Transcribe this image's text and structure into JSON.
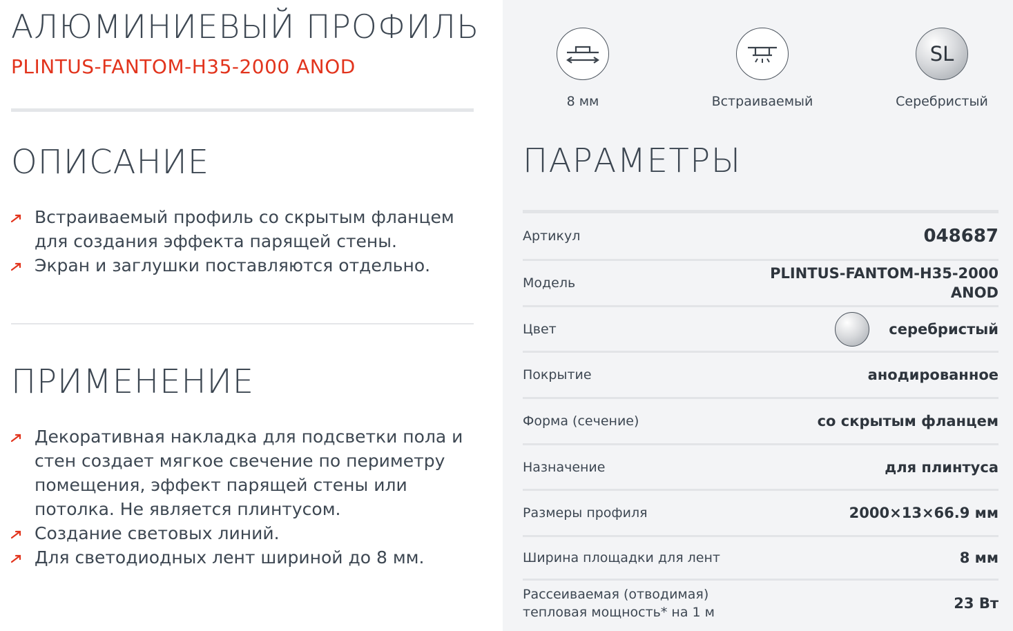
{
  "product": {
    "title": "АЛЮМИНИЕВЫЙ ПРОФИЛЬ",
    "model": "PLINTUS-FANTOM-H35-2000 ANOD"
  },
  "description": {
    "heading": "ОПИСАНИЕ",
    "items": [
      "Встраиваемый профиль со скрытым фланцем для создания эффекта парящей стены.",
      "Экран и заглушки поставляются отдельно."
    ]
  },
  "application": {
    "heading": "ПРИМЕНЕНИЕ",
    "items": [
      "Декоративная накладка для подсветки пола и стен создает мягкое свечение по периметру помещения, эффект парящей стены или потолка. Не является плинтусом.",
      "Создание световых линий.",
      "Для светодиодных лент шириной до 8 мм."
    ]
  },
  "features": [
    {
      "icon": "strip-width-icon",
      "caption": "8 мм"
    },
    {
      "icon": "recessed-mount-icon",
      "caption": "Встраиваемый"
    },
    {
      "icon_text": "SL",
      "caption": "Серебристый"
    }
  ],
  "params": {
    "heading": "ПАРАМЕТРЫ",
    "rows": [
      {
        "label": "Артикул",
        "value": "048687"
      },
      {
        "label": "Модель",
        "value_line1": "PLINTUS-FANTOM-H35-2000",
        "value_line2": "ANOD"
      },
      {
        "label": "Цвет",
        "value": "серебристый"
      },
      {
        "label": "Покрытие",
        "value": "анодированное"
      },
      {
        "label": "Форма (сечение)",
        "value": "со скрытым фланцем"
      },
      {
        "label": "Назначение",
        "value": "для плинтуса"
      },
      {
        "label": "Размеры профиля",
        "value": "2000×13×66.9 мм"
      },
      {
        "label": "Ширина площадки для лент",
        "value": "8 мм"
      },
      {
        "label_line1": "Рассеиваемая (отводимая)",
        "label_line2": "тепловая мощность* на 1 м",
        "value": "23 Вт"
      }
    ]
  },
  "colors": {
    "accent": "#e2341d",
    "text": "#3d4752",
    "panel_bg": "#f3f4f6"
  }
}
